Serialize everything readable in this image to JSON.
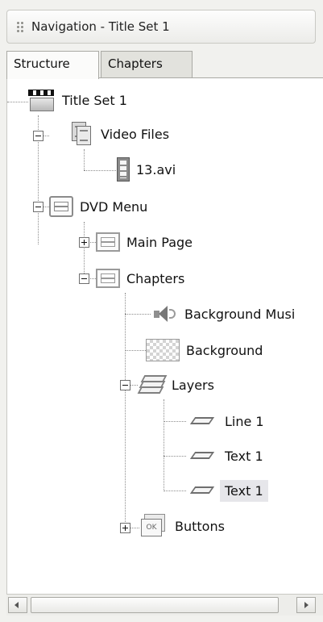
{
  "panel": {
    "title": "Navigation - Title Set 1"
  },
  "tabs": [
    {
      "label": "Structure",
      "active": true
    },
    {
      "label": "Chapters",
      "active": false
    }
  ],
  "tree": {
    "title_set": "Title Set 1",
    "video_files": "Video Files",
    "video_file_1": "13.avi",
    "dvd_menu": "DVD Menu",
    "main_page": "Main Page",
    "chapters": "Chapters",
    "background_music": "Background Musi",
    "background": "Background",
    "layers": "Layers",
    "line_1": "Line 1",
    "text_1a": "Text 1",
    "text_1b": "Text 1",
    "buttons": "Buttons",
    "selected_item": "Text 1"
  },
  "icons": {
    "title_set": "clapperboard-icon",
    "video_files": "video-files-icon",
    "video_file": "filmstrip-icon",
    "dvd_menu": "menu-icon",
    "main_page": "menu-page-icon",
    "chapters": "menu-page-icon",
    "background_music": "speaker-icon",
    "background": "checkerboard-icon",
    "layers": "layers-icon",
    "layer_item": "shape-icon",
    "buttons": "ok-button-icon"
  }
}
